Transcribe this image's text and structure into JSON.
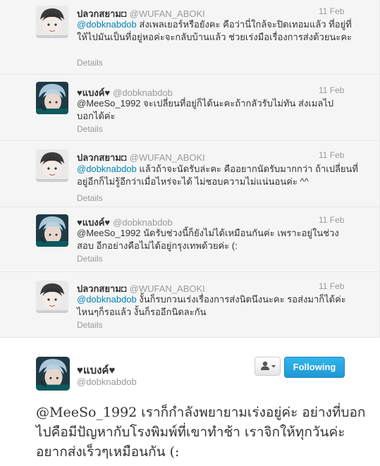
{
  "colors": {
    "accent": "#1f98d6",
    "mention": "#0084b4",
    "muted": "#999999"
  },
  "tweets": [
    {
      "fullname": "ปลวกสยาม◘",
      "screen_name": "@WUFAN_ABOKI",
      "time": "11 Feb",
      "mention": "@dobknabdob",
      "text": " ส่งเพลเยอร์หรือยังคะ คือว่านี่ใกล้จะปิดเทอมแล้ว ที่อยู่ที่ให้ไปมันเป็นที่อยู่หอค่ะจะกลับบ้านแล้ว ช่วยเร่งมือเรื่องการส่งด้วยนะคะ",
      "details": "Details",
      "avatar": "boy-avatar"
    },
    {
      "fullname": "♥แบงค์♥",
      "screen_name": "@dobknabdob",
      "time": "11 Feb",
      "mention": "@MeeSo_1992",
      "text": " จะเปลี่ยนที่อยู่ก็ได้นะคะถ้ากลัวรับไม่ทัน ส่งเมลไปบอกได้ค่ะ",
      "details": "Details",
      "avatar": "blue-hair-avatar"
    },
    {
      "fullname": "ปลวกสยาม◘",
      "screen_name": "@WUFAN_ABOKI",
      "time": "11 Feb",
      "mention": "@dobknabdob",
      "text": " แล้วถ้าจะนัดรับล่ะคะ คืออยากนัดรับมากกว่า ถ้าเปลี่ยนที่อยู่อีกก็ไม่รู้อีกว่าเมื่อไหร่จะได้ ไม่ชอบความไม่แน่นอนค่ะ ^^",
      "details": "Details",
      "avatar": "boy-avatar"
    },
    {
      "fullname": "♥แบงค์♥",
      "screen_name": "@dobknabdob",
      "time": "11 Feb",
      "mention": "@MeeSo_1992",
      "text": " นัดรับช่วงนี้ก็ยังไม่ได้เหมือนกันค่ะ เพราะอยู่ในช่วงสอบ อีกอย่างคือไม่ได้อยู่กรุงเทพด้วยค่ะ (:",
      "details": "Details",
      "avatar": "blue-hair-avatar"
    },
    {
      "fullname": "ปลวกสยาม◘",
      "screen_name": "@WUFAN_ABOKI",
      "time": "11 Feb",
      "mention": "@dobknabdob",
      "text": " งั้นก็รบกวนเร่งเรื่องการส่งนิดนึงนะคะ รอส่งมาก็ได้ค่ะ ไหนๆก็รอแล้ว งั้นก็รออีกนิดละกัน",
      "details": "Details",
      "avatar": "boy-avatar"
    }
  ],
  "main_tweet": {
    "fullname": "♥แบงค์♥",
    "screen_name": "@dobknabdob",
    "follow_label": "Following",
    "user_menu_icon": "user-dropdown-icon",
    "text": "@MeeSo_1992 เราก็กำลังพยายามเร่งอยู่ค่ะ อย่างที่บอกไปคือมีปัญหากับโรงพิมพ์ที่เขาทำช้า เราจิกให้ทุกวันค่ะ อยากส่งเร็วๆเหมือนกัน (:"
  }
}
